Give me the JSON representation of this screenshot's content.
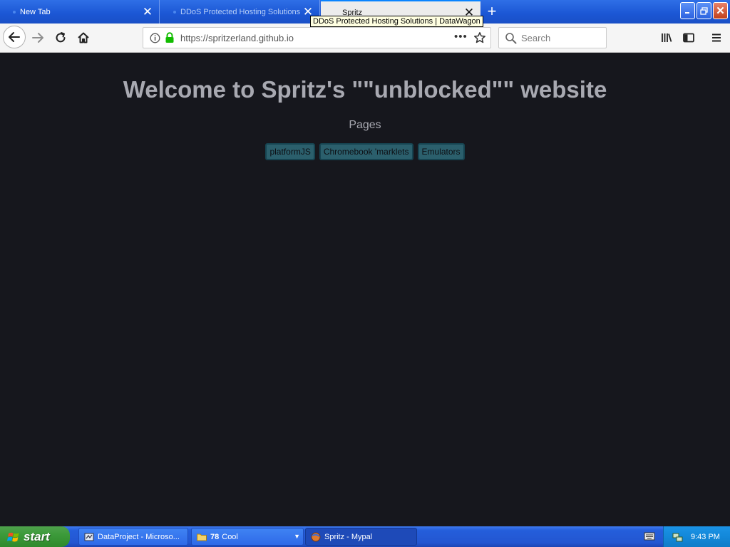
{
  "browser": {
    "tabs": [
      {
        "label": "New Tab",
        "active": false
      },
      {
        "label": "DDoS Protected Hosting Solutions | DataWagon",
        "active": false
      },
      {
        "label": "Spritz",
        "active": true
      }
    ],
    "tooltip": "DDoS Protected Hosting Solutions | DataWagon",
    "url": "https://spritzerland.github.io",
    "search_placeholder": "Search",
    "accent_color": "#0a84ff"
  },
  "page": {
    "title": "Welcome to Spritz's \"\"unblocked\"\" website",
    "pages_heading": "Pages",
    "links": [
      "platformJS",
      "Chromebook 'marklets",
      "Emulators"
    ],
    "background_color": "#16171d",
    "link_color": "#2b5f6c"
  },
  "taskbar": {
    "start_label": "start",
    "tasks": [
      {
        "label": "DataProject - Microso...",
        "icon": "app-icon"
      },
      {
        "label": "Cool",
        "count": "78",
        "icon": "folder-icon"
      },
      {
        "label": "Spritz - Mypal",
        "icon": "browser-icon",
        "active": true
      }
    ],
    "clock": "9:43 PM"
  }
}
